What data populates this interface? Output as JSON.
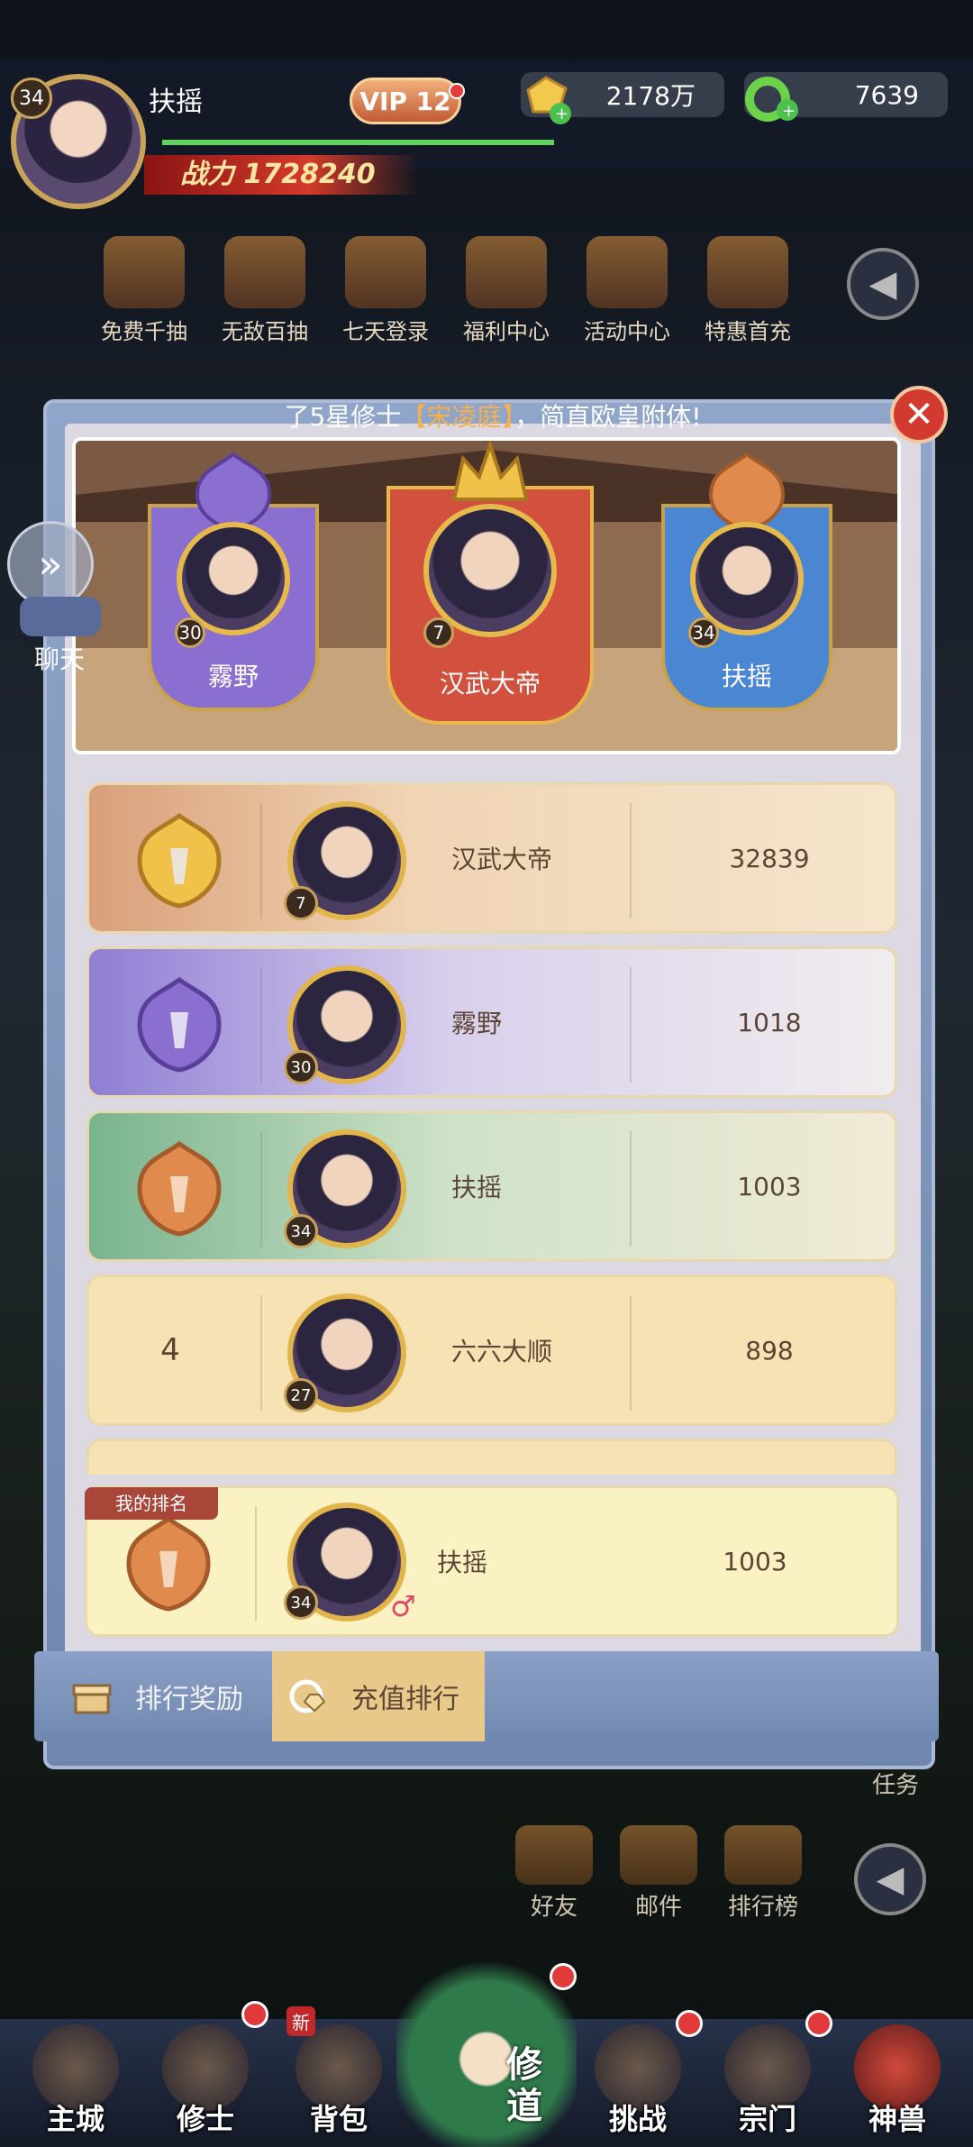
{
  "player": {
    "level": "34",
    "name": "扶摇",
    "vip": "VIP 12",
    "power_label": "战力",
    "power": "1728240"
  },
  "currency": {
    "gold": "2178万",
    "gems": "7639"
  },
  "activities": [
    {
      "label": "免费千抽",
      "icon": "gift-icon"
    },
    {
      "label": "无敌百抽",
      "icon": "scroll-icon"
    },
    {
      "label": "七天登录",
      "icon": "chest-icon"
    },
    {
      "label": "福利中心",
      "icon": "lucky-bag-icon"
    },
    {
      "label": "活动中心",
      "icon": "dragon-icon"
    },
    {
      "label": "特惠首充",
      "icon": "treasure-icon"
    }
  ],
  "ticker": {
    "pre": "了5星修士",
    "highlight": "【宋凌庭】",
    "post": "，简直欧皇附体!"
  },
  "chat": {
    "label": "聊天"
  },
  "podium": [
    {
      "rank": 2,
      "name": "霧野",
      "level": "30",
      "color": "#8b6fd0"
    },
    {
      "rank": 1,
      "name": "汉武大帝",
      "level": "7",
      "color": "#d2503e"
    },
    {
      "rank": 3,
      "name": "扶摇",
      "level": "34",
      "color": "#4a86d2"
    }
  ],
  "rows": [
    {
      "rank": "",
      "medal": "gold-medal-icon",
      "name": "汉武大帝",
      "level": "7",
      "score": "32839"
    },
    {
      "rank": "",
      "medal": "purple-medal-icon",
      "name": "霧野",
      "level": "30",
      "score": "1018"
    },
    {
      "rank": "",
      "medal": "bronze-medal-icon",
      "name": "扶摇",
      "level": "34",
      "score": "1003"
    },
    {
      "rank": "4",
      "medal": "",
      "name": "六六大顺",
      "level": "27",
      "score": "898"
    }
  ],
  "my_rank": {
    "tag": "我的排名",
    "name": "扶摇",
    "level": "34",
    "score": "1003"
  },
  "tabs": [
    {
      "label": "排行奖励",
      "icon": "reward-box-icon"
    },
    {
      "label": "充值排行",
      "icon": "recharge-icon"
    }
  ],
  "bottom_shortcuts": [
    {
      "label": "好友",
      "icon": "friends-icon"
    },
    {
      "label": "邮件",
      "icon": "mail-icon"
    },
    {
      "label": "排行榜",
      "icon": "trophy-icon"
    }
  ],
  "task_label": "任务",
  "nav": [
    {
      "label": "主城",
      "icon": "castle-icon"
    },
    {
      "label": "修士",
      "icon": "cultivator-icon"
    },
    {
      "label": "背包",
      "icon": "bag-icon",
      "badge": "新"
    },
    {
      "label": "修道",
      "icon": "dragon-cultivation-icon"
    },
    {
      "label": "挑战",
      "icon": "challenge-icon"
    },
    {
      "label": "宗门",
      "icon": "sect-icon"
    },
    {
      "label": "神兽",
      "icon": "beast-icon"
    }
  ],
  "colors": {
    "accent": "#e9c98a",
    "close": "#d23a30",
    "gold": "#e7b94a"
  }
}
